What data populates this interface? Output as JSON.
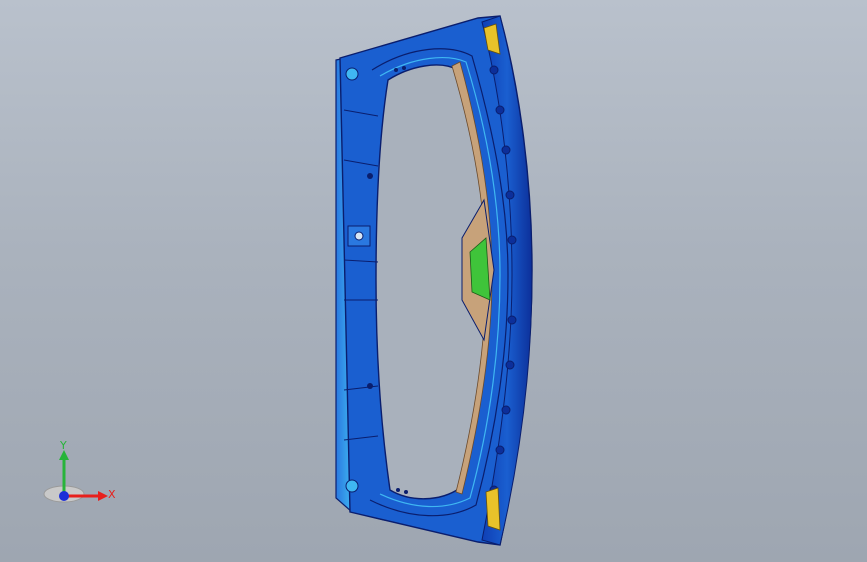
{
  "viewport": {
    "background_top": "#b9c1cc",
    "background_bottom": "#9ea6b1"
  },
  "model": {
    "name": "",
    "primary_color": "#1a5fd0",
    "highlight_color": "#3fb7f2",
    "edge_color": "#0a1e6e",
    "inner_trim_color": "#c7a27a",
    "accent_green": "#3fc43a",
    "accent_yellow": "#e8c22a"
  },
  "triad": {
    "x_label": "X",
    "y_label": "Y",
    "x_color": "#e8201c",
    "y_color": "#27b43a",
    "z_color": "#1d2fd8"
  }
}
